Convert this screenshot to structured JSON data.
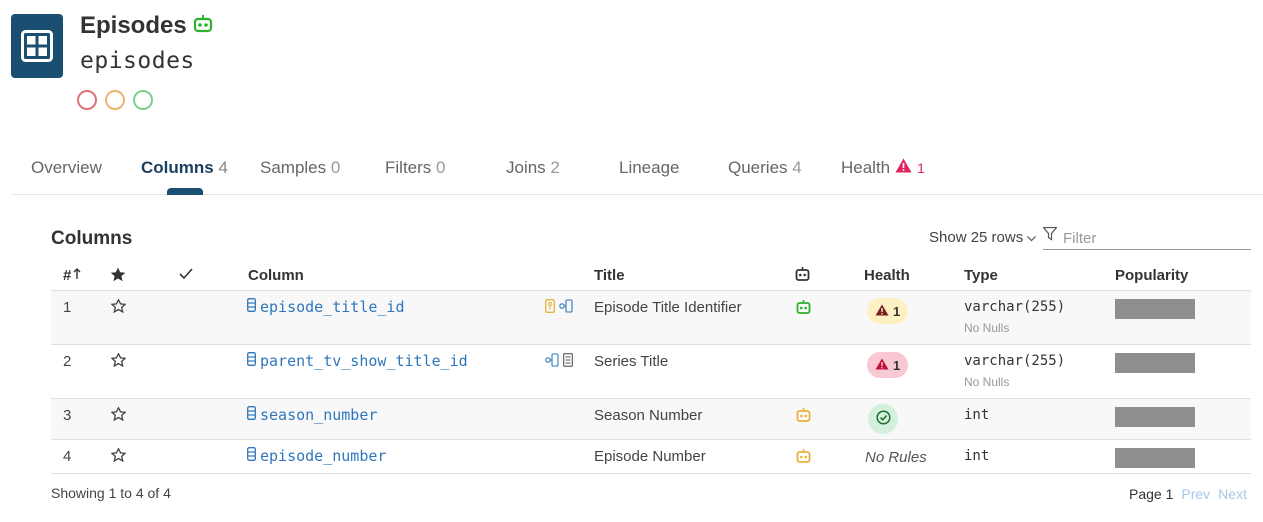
{
  "header": {
    "title": "Episodes",
    "subtitle": "episodes",
    "status_circles": [
      "#e0737d",
      "#e8b56b",
      "#7fcf8c"
    ]
  },
  "tabs": [
    {
      "label": "Overview",
      "count": ""
    },
    {
      "label": "Columns",
      "count": "4"
    },
    {
      "label": "Samples",
      "count": "0"
    },
    {
      "label": "Filters",
      "count": "0"
    },
    {
      "label": "Joins",
      "count": "2"
    },
    {
      "label": "Lineage",
      "count": ""
    },
    {
      "label": "Queries",
      "count": "4"
    },
    {
      "label": "Health",
      "count": "1"
    }
  ],
  "section": {
    "title": "Columns",
    "show_rows": "Show 25 rows",
    "filter_placeholder": "Filter"
  },
  "table": {
    "headers": {
      "index": "#",
      "column": "Column",
      "title": "Title",
      "health": "Health",
      "type": "Type",
      "popularity": "Popularity"
    },
    "rows": [
      {
        "index": "1",
        "column": "episode_title_id",
        "title": "Episode Title Identifier",
        "health": "1",
        "type": "varchar(255)",
        "note": "No Nulls"
      },
      {
        "index": "2",
        "column": "parent_tv_show_title_id",
        "title": "Series Title",
        "health": "1",
        "type": "varchar(255)",
        "note": "No Nulls"
      },
      {
        "index": "3",
        "column": "season_number",
        "title": "Season Number",
        "health": "",
        "type": "int",
        "note": ""
      },
      {
        "index": "4",
        "column": "episode_number",
        "title": "Episode Number",
        "health": "No Rules",
        "type": "int",
        "note": ""
      }
    ]
  },
  "footer": {
    "showing": "Showing 1 to 4 of 4",
    "page": "Page 1",
    "prev": "Prev",
    "next": "Next"
  },
  "colors": {
    "brand": "#1b4f72",
    "link": "#2f77bc",
    "robot_green": "#2bb32b",
    "robot_yellow": "#e8b23a",
    "alert_red": "#e0245e"
  }
}
